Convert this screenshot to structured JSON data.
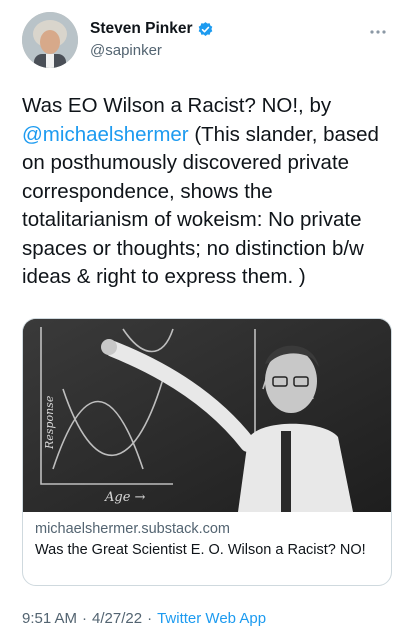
{
  "author": {
    "display_name": "Steven Pinker",
    "handle": "@sapinker",
    "verified": true,
    "verified_color": "#1d9bf0"
  },
  "tweet": {
    "text_before_mention": "Was EO Wilson a Racist? NO!, by ",
    "mention": "@michaelshermer",
    "text_after_mention": " (This slander, based on posthumously discovered private correspondence, shows the totalitarianism of wokeism: No private spaces or thoughts; no distinction b/w ideas & right to express them. )"
  },
  "link_card": {
    "domain": "michaelshermer.substack.com",
    "title": "Was the Great Scientist E. O. Wilson a Racist? NO!",
    "image_icon": "photo-man-at-blackboard-icon",
    "image_labels": {
      "x_axis": "Age →",
      "y_axis": "Response"
    }
  },
  "meta": {
    "time": "9:51 AM",
    "separator": "·",
    "date": "4/27/22",
    "source": "Twitter Web App"
  },
  "icons": {
    "more": "more-horizontal-icon",
    "verified": "verified-badge-icon"
  },
  "colors": {
    "link": "#1d9bf0",
    "secondary_text": "#536471",
    "border": "#cfd9de"
  }
}
